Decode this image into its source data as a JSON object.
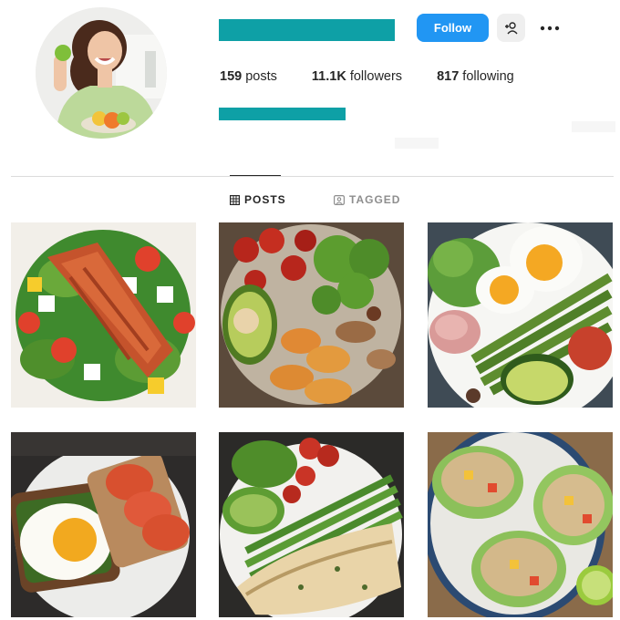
{
  "profile": {
    "avatar_icon": "profile-photo-woman-with-fruit",
    "username_redacted_color": "#0ea0a6",
    "bio_redacted_color": "#0ea0a6",
    "follow_label": "Follow",
    "follow_color": "#2196f3",
    "suggest_icon": "add-person-icon",
    "more_icon": "more-options-icon",
    "stats": {
      "posts_count": "159",
      "posts_label": "posts",
      "followers_count": "11.1K",
      "followers_label": "followers",
      "following_count": "817",
      "following_label": "following"
    }
  },
  "tabs": [
    {
      "label": "POSTS",
      "icon": "grid-icon",
      "active": true
    },
    {
      "label": "TAGGED",
      "icon": "tagged-icon",
      "active": false
    }
  ],
  "posts": [
    {
      "icon": "salmon-salad-photo"
    },
    {
      "icon": "broccoli-avocado-potato-bowl-photo"
    },
    {
      "icon": "eggs-asparagus-avocado-plate-photo"
    },
    {
      "icon": "egg-tomato-toast-photo"
    },
    {
      "icon": "chicken-asparagus-avocado-plate-photo"
    },
    {
      "icon": "lettuce-wraps-photo"
    }
  ]
}
